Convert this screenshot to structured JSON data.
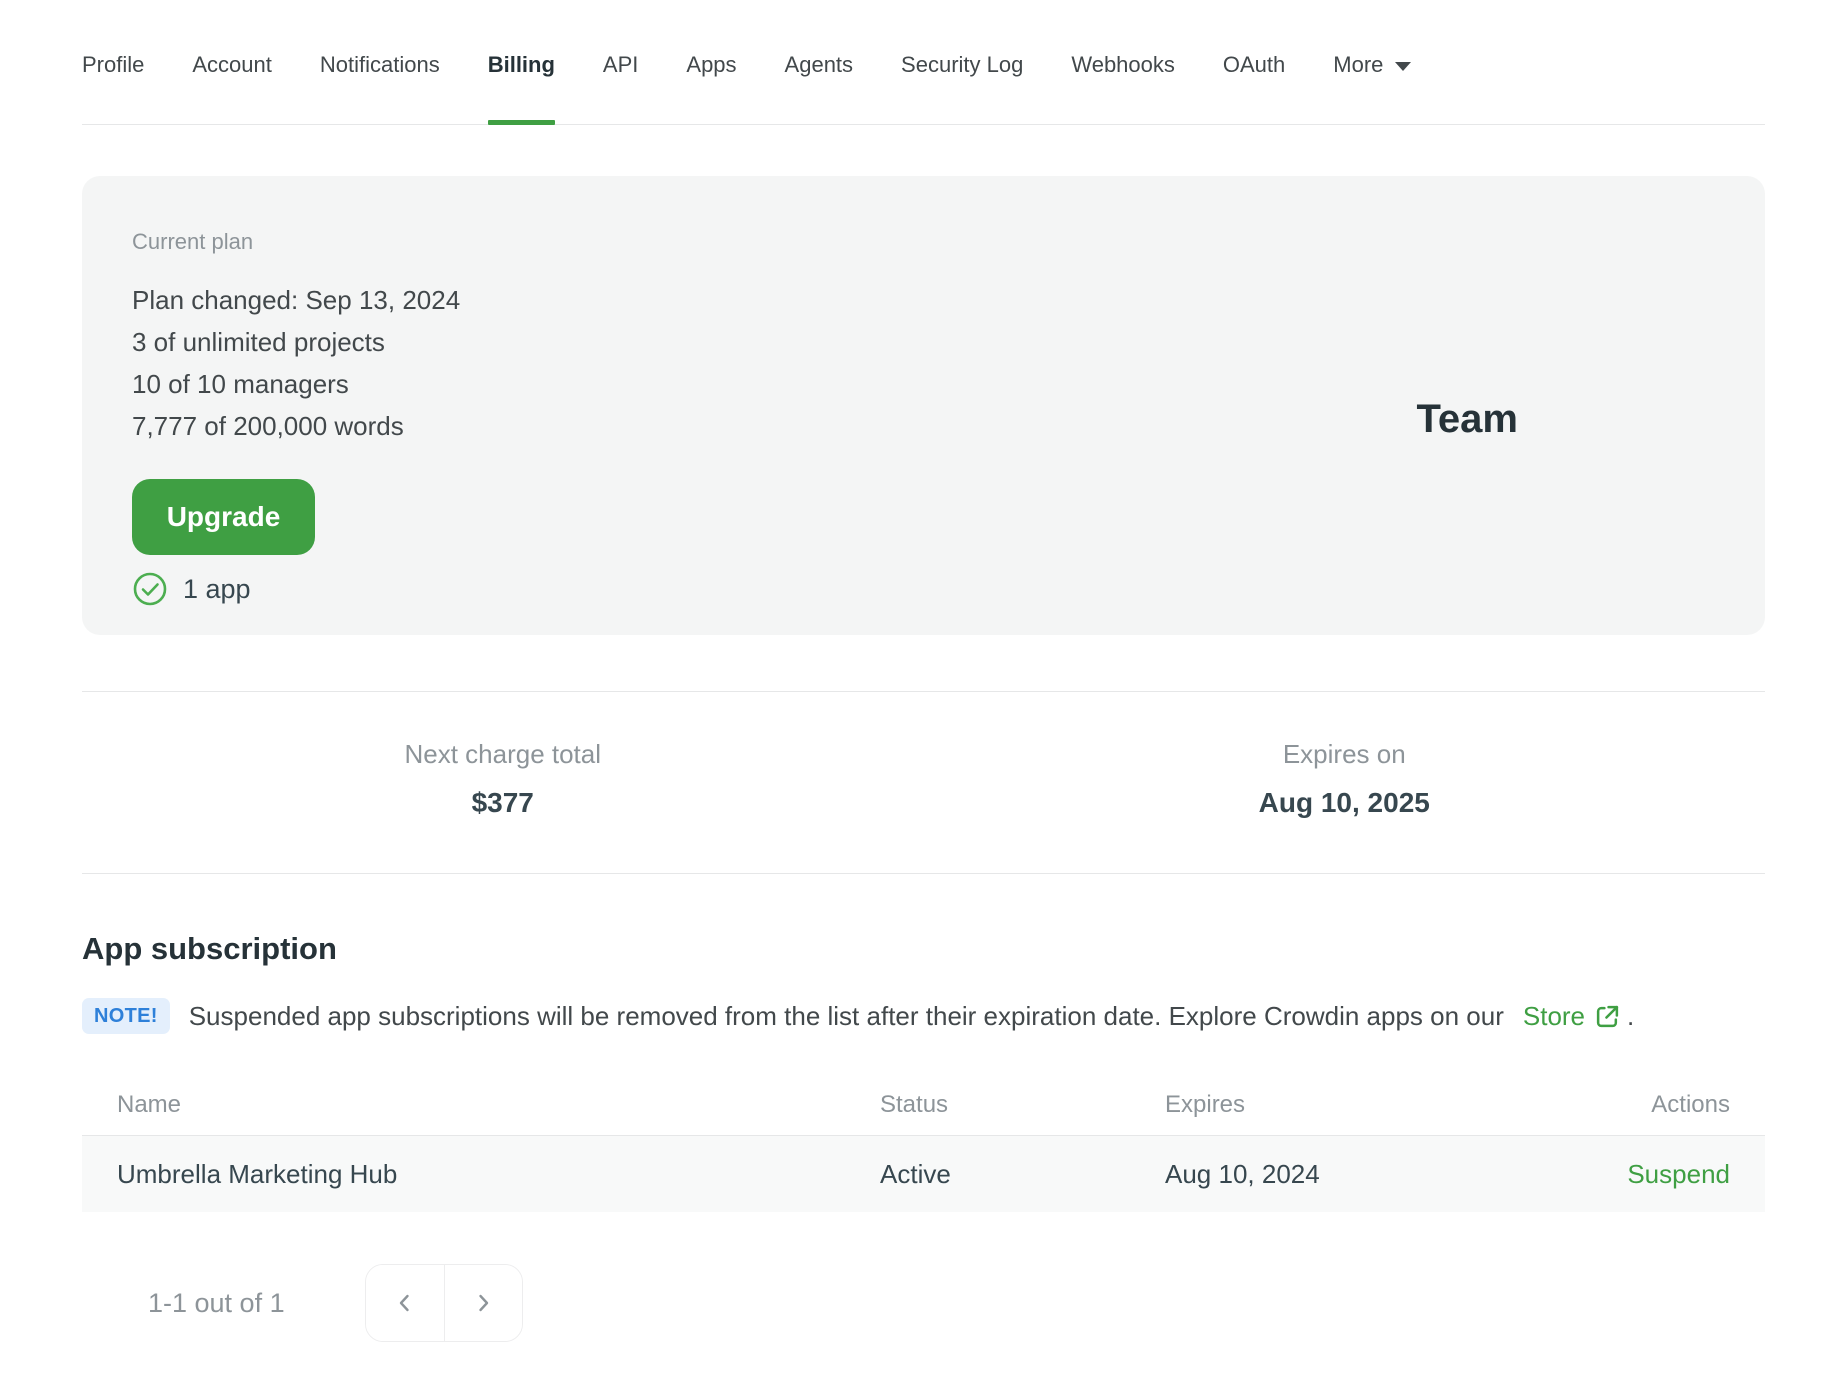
{
  "nav": {
    "tabs": [
      {
        "label": "Profile"
      },
      {
        "label": "Account"
      },
      {
        "label": "Notifications"
      },
      {
        "label": "Billing"
      },
      {
        "label": "API"
      },
      {
        "label": "Apps"
      },
      {
        "label": "Agents"
      },
      {
        "label": "Security Log"
      },
      {
        "label": "Webhooks"
      },
      {
        "label": "OAuth"
      }
    ],
    "active_tab": "Billing",
    "more_label": "More"
  },
  "plan_card": {
    "label": "Current plan",
    "lines": [
      "Plan changed: Sep 13, 2024",
      "3 of unlimited projects",
      "10 of 10 managers",
      "7,777 of 200,000 words"
    ],
    "upgrade_label": "Upgrade",
    "apps_count": "1 app",
    "plan_name": "Team"
  },
  "billing_summary": {
    "next_charge_label": "Next charge total",
    "next_charge_value": "$377",
    "expires_label": "Expires on",
    "expires_value": "Aug 10, 2025"
  },
  "app_subscription": {
    "title": "App subscription",
    "note_badge": "NOTE!",
    "note_text": "Suspended app subscriptions will be removed from the list after their expiration date. Explore Crowdin apps on our",
    "note_link_label": "Store",
    "note_suffix": ".",
    "table": {
      "headers": [
        "Name",
        "Status",
        "Expires",
        "Actions"
      ],
      "rows": [
        {
          "name": "Umbrella Marketing Hub",
          "status": "Active",
          "expires": "Aug 10, 2024",
          "action": "Suspend"
        }
      ]
    },
    "pagination": {
      "label": "1-1 out of 1"
    }
  },
  "colors": {
    "accent_green": "#3f9f43",
    "note_blue": "#2e80d9",
    "note_blue_bg": "#e4effc",
    "card_bg": "#f4f5f5",
    "row_bg": "#f8f9f9",
    "text_dark": "#263238",
    "text_muted": "#8d9499"
  }
}
